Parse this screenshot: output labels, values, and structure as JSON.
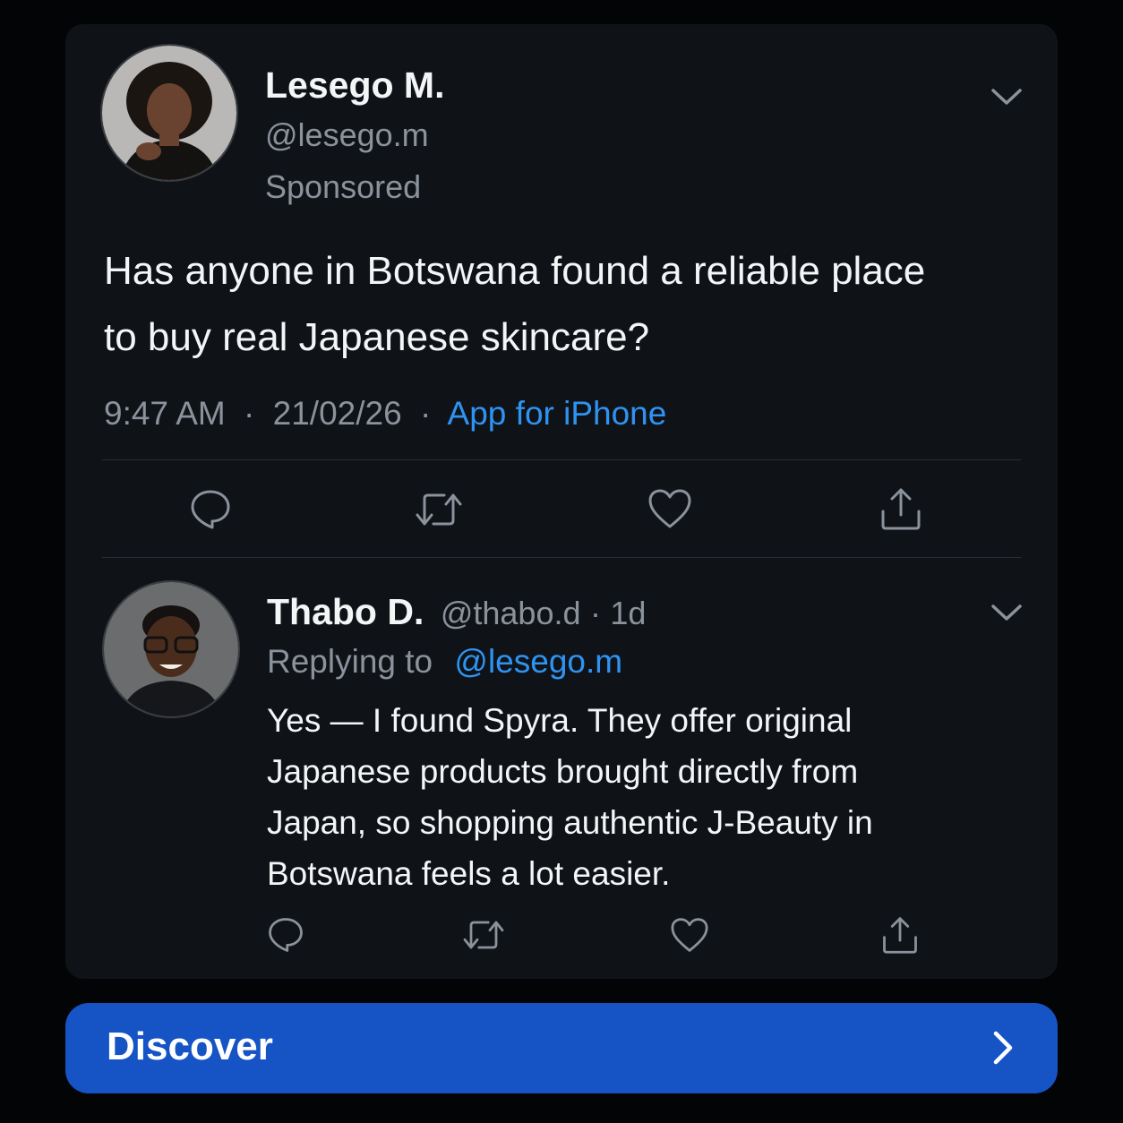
{
  "post": {
    "author_name": "Lesego M.",
    "author_handle": "@lesego.m",
    "sponsored_label": "Sponsored",
    "text": "Has anyone in Botswana found a reliable place to buy real Japanese skincare?",
    "time": "9:47 AM",
    "separator": "·",
    "date": "21/02/26",
    "source": "App for iPhone",
    "avatar_icon": "user-avatar",
    "menu_icon": "chevron-down-icon",
    "actions": [
      "reply-icon",
      "retweet-icon",
      "like-icon",
      "share-icon"
    ]
  },
  "reply": {
    "author_name": "Thabo D.",
    "author_handle": "@thabo.d",
    "separator": "·",
    "age": "1d",
    "replying_to_label": "Replying to",
    "replying_to_handle": "@lesego.m",
    "text": "Yes — I found Spyra. They offer original Japanese products brought directly from Japan, so shopping authentic J-Beauty in Botswana feels a lot easier.",
    "avatar_icon": "user-avatar",
    "menu_icon": "chevron-down-icon",
    "actions": [
      "reply-icon",
      "retweet-icon",
      "like-icon",
      "share-icon"
    ]
  },
  "cta": {
    "label": "Discover",
    "icon": "chevron-right-icon",
    "color": "#1654c6"
  },
  "colors": {
    "background": "#030405",
    "card": "#0f1318",
    "link": "#2f93f2",
    "muted": "#8b929b"
  }
}
